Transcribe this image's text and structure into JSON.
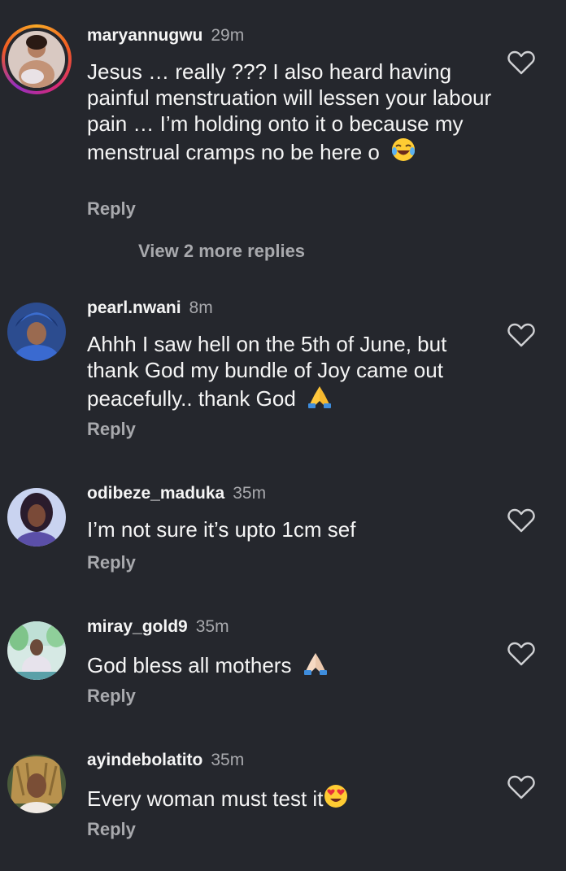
{
  "comments": [
    {
      "username": "maryannugwu",
      "time": "29m",
      "text": "Jesus … really ??? I also heard having painful menstruation will lessen your labour pain … I’m holding onto it o because my menstrual cramps no be here o",
      "emoji": "laughing-tears-emoji",
      "reply_label": "Reply",
      "has_story_ring": true,
      "view_more": "View 2 more replies"
    },
    {
      "username": "pearl.nwani",
      "time": "8m",
      "text": "Ahhh I saw hell on the 5th of June, but thank God my bundle of Joy came out peacefully.. thank God",
      "emoji": "folded-hands-emoji",
      "reply_label": "Reply"
    },
    {
      "username": "odibeze_maduka",
      "time": "35m",
      "text": "I’m not sure it’s upto 1cm sef",
      "reply_label": "Reply"
    },
    {
      "username": "miray_gold9",
      "time": "35m",
      "text": "God bless all mothers",
      "emoji": "folded-hands-light-emoji",
      "reply_label": "Reply"
    },
    {
      "username": "ayindebolatito",
      "time": "35m",
      "text": "Every woman must test it",
      "emoji": "heart-eyes-emoji",
      "reply_label": "Reply"
    }
  ],
  "colors": {
    "background": "#25272d",
    "muted": "#a8a9ad",
    "text": "#f5f5f5"
  }
}
